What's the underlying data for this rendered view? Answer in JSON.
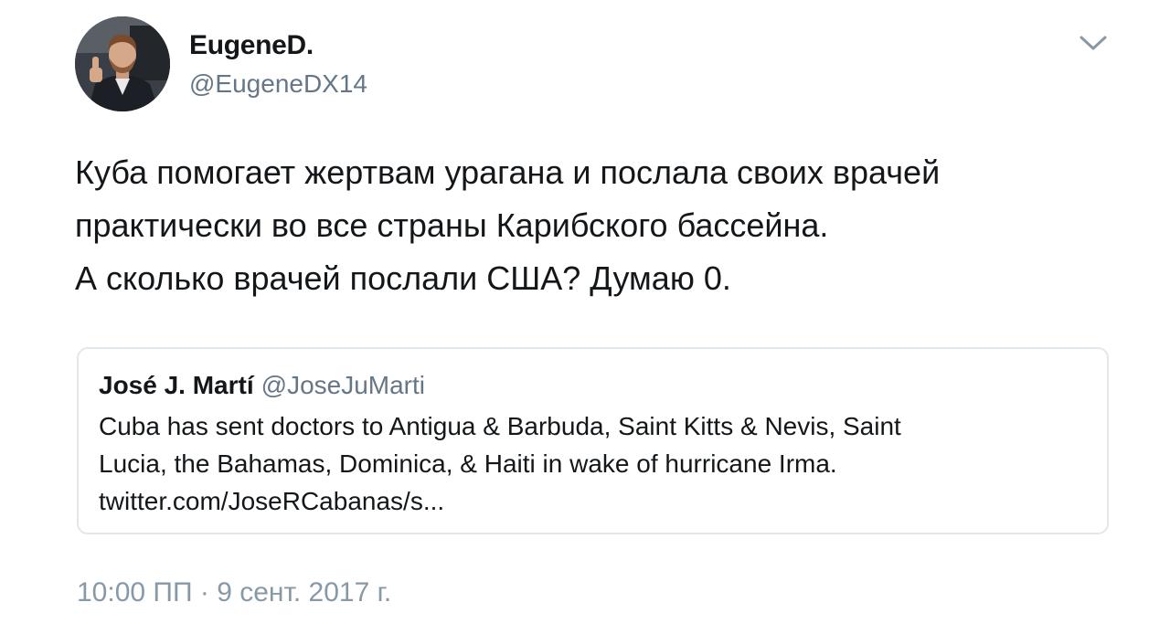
{
  "author": {
    "display_name": "EugeneD.",
    "handle": "@EugeneDX14",
    "avatar_icon": "user-photo-avatar"
  },
  "menu": {
    "icon": "chevron-down-icon"
  },
  "tweet": {
    "lines": [
      "Куба помогает жертвам урагана и послала своих врачей",
      "практически во все страны Карибского бассейна.",
      "А сколько врачей послали США? Думаю 0."
    ]
  },
  "quoted_tweet": {
    "display_name": "José J. Martí",
    "handle": "@JoseJuMarti",
    "lines": [
      "Cuba has sent doctors to Antigua & Barbuda, Saint Kitts & Nevis, Saint",
      "Lucia, the Bahamas, Dominica, & Haiti in wake of hurricane Irma.",
      "twitter.com/JoseRCabanas/s..."
    ]
  },
  "timestamp": "10:00 ПП · 9 сент. 2017 г.",
  "colors": {
    "text_primary": "#14171a",
    "text_secondary": "#657786",
    "timestamp": "#8899a6",
    "border": "#e1e8ed"
  }
}
